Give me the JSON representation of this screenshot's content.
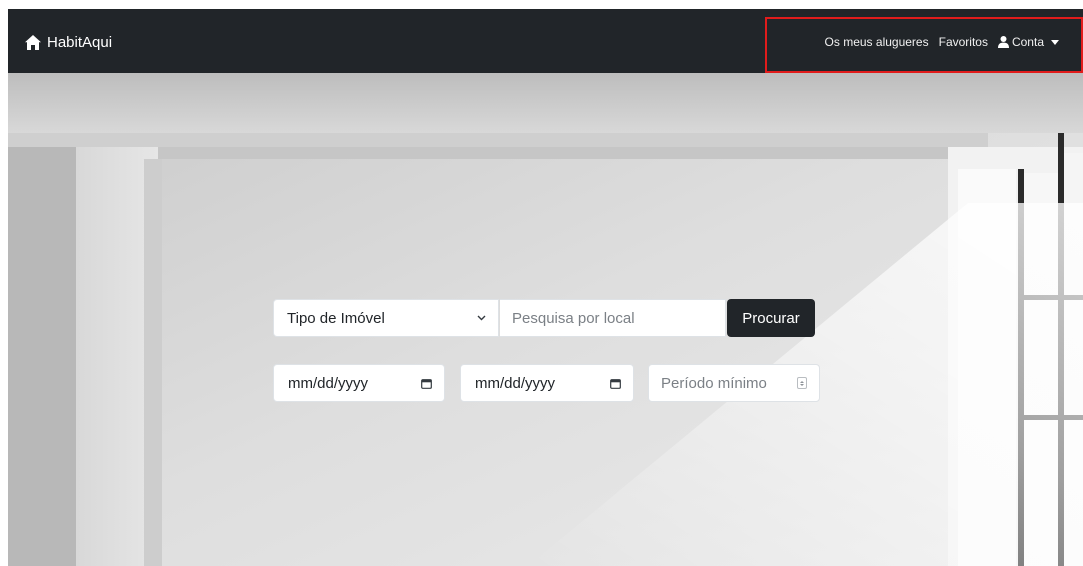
{
  "navbar": {
    "brand": "HabitAqui",
    "links": {
      "rentals": "Os meus alugueres",
      "favorites": "Favoritos",
      "account": "Conta"
    }
  },
  "search": {
    "property_type_label": "Tipo de Imóvel",
    "location_placeholder": "Pesquisa por local",
    "submit_label": "Procurar"
  },
  "dates": {
    "start_placeholder": "mm/dd/yyyy",
    "end_placeholder": "mm/dd/yyyy"
  },
  "min_period": {
    "placeholder": "Período mínimo"
  },
  "colors": {
    "navbar_bg": "#212529",
    "highlight_border": "#e11c1c",
    "button_bg": "#212529"
  },
  "icons": {
    "brand": "home-icon",
    "account": "user-icon",
    "dropdown": "caret-down-icon",
    "select": "chevron-down-icon",
    "date": "calendar-icon",
    "number": "spinner-icon"
  }
}
